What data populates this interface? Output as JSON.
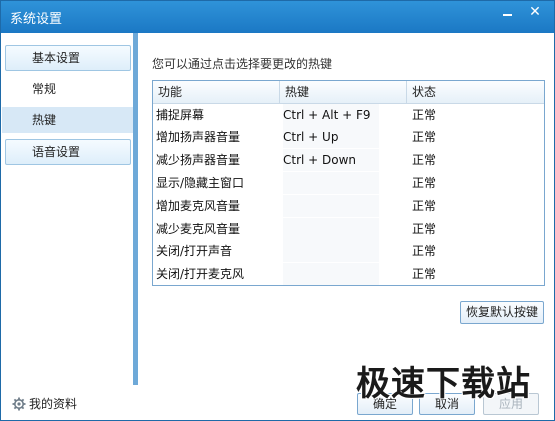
{
  "window": {
    "title": "系统设置",
    "minimize_icon": "minimize-icon",
    "close_icon": "close-icon",
    "close_glyph": "✕"
  },
  "sidebar": {
    "basic_label": "基本设置",
    "general_label": "常规",
    "hotkey_label": "热键",
    "voice_label": "语音设置"
  },
  "main": {
    "hint": "您可以通过点击选择要更改的热键",
    "table": {
      "headers": [
        "功能",
        "热键",
        "状态"
      ],
      "rows": [
        {
          "function": "捕捉屏幕",
          "hotkey": "Ctrl + Alt + F9",
          "status": "正常"
        },
        {
          "function": "增加扬声器音量",
          "hotkey": "Ctrl + Up",
          "status": "正常"
        },
        {
          "function": "减少扬声器音量",
          "hotkey": "Ctrl + Down",
          "status": "正常"
        },
        {
          "function": "显示/隐藏主窗口",
          "hotkey": "",
          "status": "正常"
        },
        {
          "function": "增加麦克风音量",
          "hotkey": "",
          "status": "正常"
        },
        {
          "function": "减少麦克风音量",
          "hotkey": "",
          "status": "正常"
        },
        {
          "function": "关闭/打开声音",
          "hotkey": "",
          "status": "正常"
        },
        {
          "function": "关闭/打开麦克风",
          "hotkey": "",
          "status": "正常"
        }
      ]
    },
    "restore_label": "恢复默认按键"
  },
  "footer": {
    "profile_label": "我的资料",
    "profile_icon": "gear-icon",
    "ok_label": "确定",
    "cancel_label": "取消",
    "apply_label": "应用"
  },
  "watermark": {
    "text": "极速下载站"
  },
  "colors": {
    "titlebar": "#1b78c4",
    "selected_item": "#d7e8f6",
    "border": "#7aa7cf"
  }
}
